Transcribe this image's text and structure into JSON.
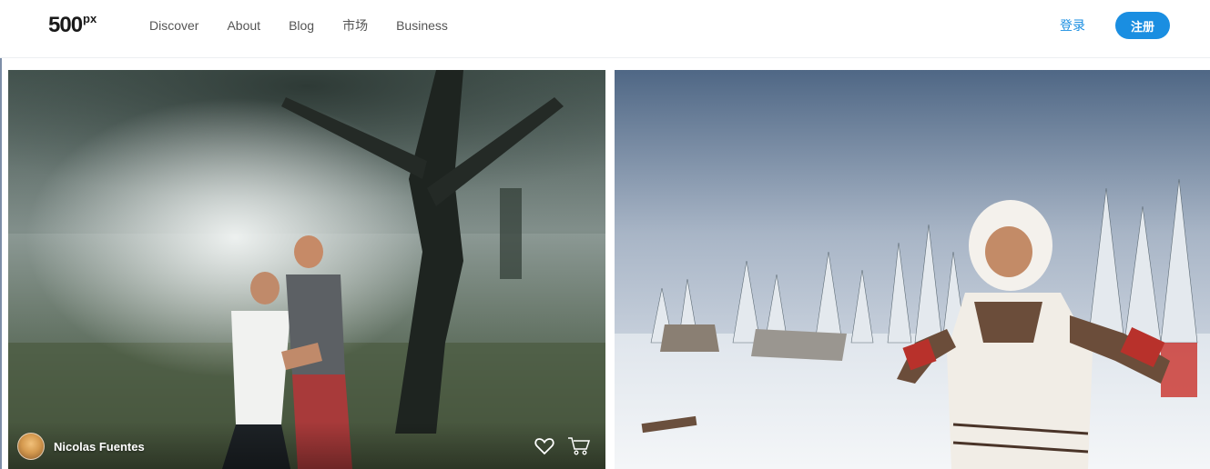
{
  "header": {
    "logo_main": "500",
    "logo_sup": "px",
    "nav": [
      {
        "label": "Discover"
      },
      {
        "label": "About"
      },
      {
        "label": "Blog"
      },
      {
        "label": "市场"
      },
      {
        "label": "Business"
      }
    ],
    "login_label": "登录",
    "signup_label": "注册"
  },
  "photos": [
    {
      "author": "Nicolas Fuentes",
      "icons": [
        "heart-icon",
        "cart-icon"
      ]
    },
    {
      "author": "",
      "icons": []
    }
  ],
  "colors": {
    "accent": "#1a8ee1",
    "nav_text": "#555555"
  }
}
